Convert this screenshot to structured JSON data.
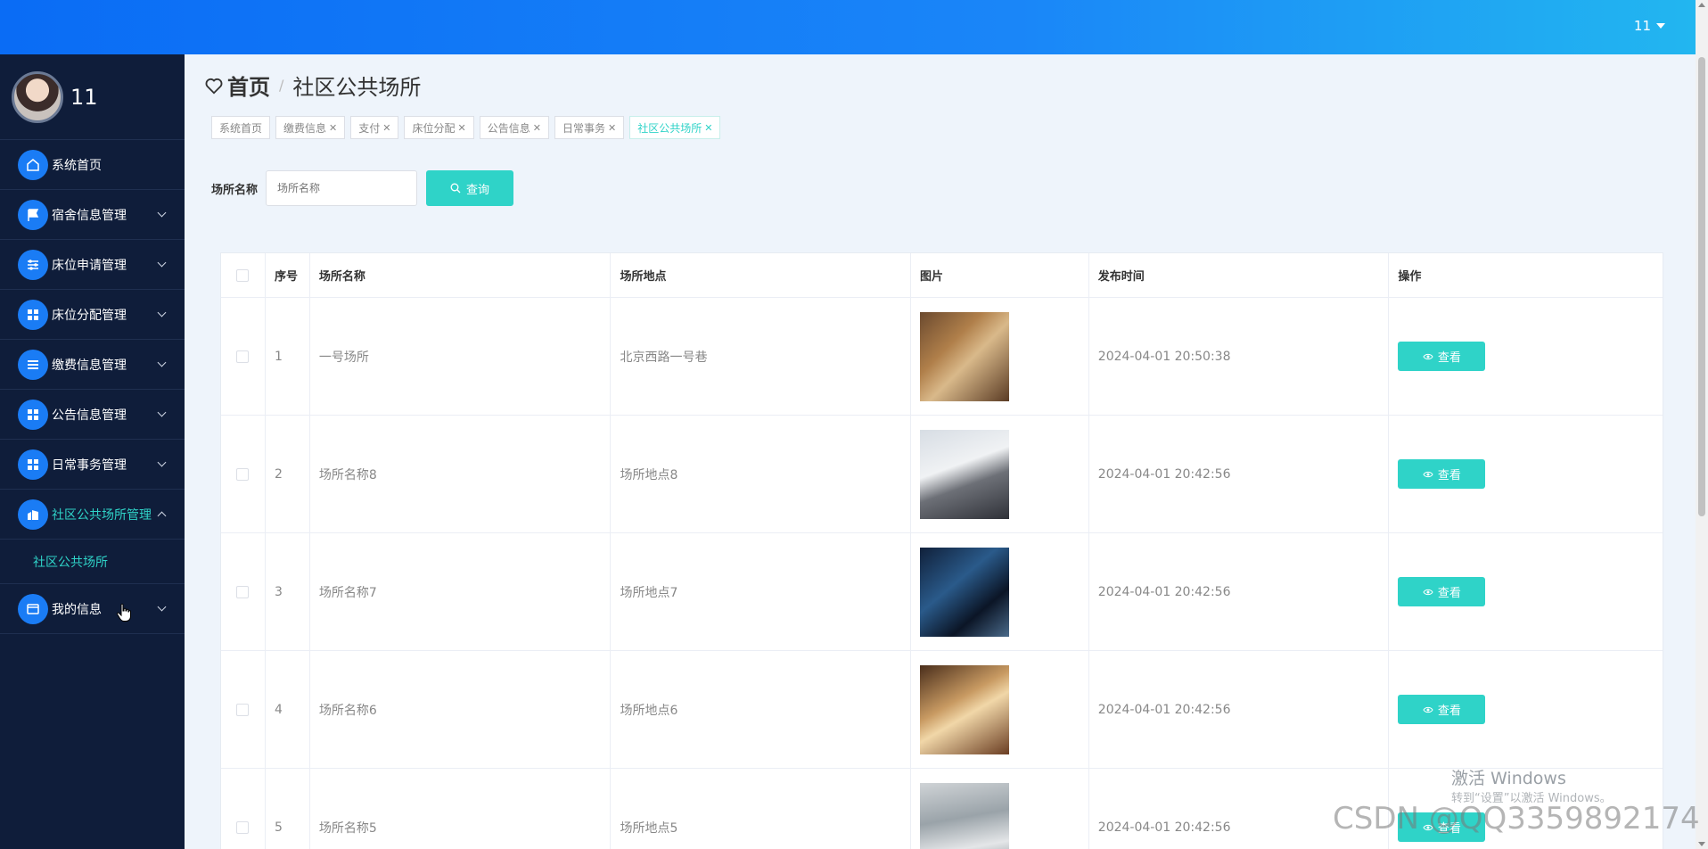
{
  "header": {
    "user": "11"
  },
  "sidebar": {
    "username": "11",
    "items": [
      {
        "label": "系统首页",
        "icon": "home-icon"
      },
      {
        "label": "宿舍信息管理",
        "icon": "flag-icon"
      },
      {
        "label": "床位申请管理",
        "icon": "sliders-icon"
      },
      {
        "label": "床位分配管理",
        "icon": "grid-icon"
      },
      {
        "label": "缴费信息管理",
        "icon": "list-icon"
      },
      {
        "label": "公告信息管理",
        "icon": "grid-icon"
      },
      {
        "label": "日常事务管理",
        "icon": "grid-icon"
      },
      {
        "label": "社区公共场所管理",
        "icon": "building-icon",
        "expanded": true
      },
      {
        "label": "我的信息",
        "icon": "card-icon"
      }
    ],
    "sub_item": "社区公共场所"
  },
  "breadcrumb": {
    "home": "首页",
    "separator": "/",
    "current": "社区公共场所"
  },
  "tabs": [
    {
      "label": "系统首页",
      "closable": false
    },
    {
      "label": "缴费信息",
      "closable": true
    },
    {
      "label": "支付",
      "closable": true
    },
    {
      "label": "床位分配",
      "closable": true
    },
    {
      "label": "公告信息",
      "closable": true
    },
    {
      "label": "日常事务",
      "closable": true
    },
    {
      "label": "社区公共场所",
      "closable": true,
      "active": true
    }
  ],
  "search": {
    "label": "场所名称",
    "placeholder": "场所名称",
    "button": "查询"
  },
  "table": {
    "headers": [
      "序号",
      "场所名称",
      "场所地点",
      "图片",
      "发布时间",
      "操作"
    ],
    "rows": [
      {
        "index": "1",
        "name": "一号场所",
        "location": "北京西路一号巷",
        "time": "2024-04-01 20:50:38",
        "action": "查看"
      },
      {
        "index": "2",
        "name": "场所名称8",
        "location": "场所地点8",
        "time": "2024-04-01 20:42:56",
        "action": "查看"
      },
      {
        "index": "3",
        "name": "场所名称7",
        "location": "场所地点7",
        "time": "2024-04-01 20:42:56",
        "action": "查看"
      },
      {
        "index": "4",
        "name": "场所名称6",
        "location": "场所地点6",
        "time": "2024-04-01 20:42:56",
        "action": "查看"
      },
      {
        "index": "5",
        "name": "场所名称5",
        "location": "场所地点5",
        "time": "2024-04-01 20:42:56",
        "action": "查看"
      }
    ]
  },
  "watermark": {
    "windows_title": "激活 Windows",
    "windows_hint": "转到“设置”以激活 Windows。",
    "csdn": "CSDN @QQ3359892174"
  },
  "colors": {
    "accent": "#2fd3c8",
    "sidebar_bg": "#0f1d3a",
    "icon_bg": "#1a7cf5",
    "topbar": "#0a6cf5"
  }
}
